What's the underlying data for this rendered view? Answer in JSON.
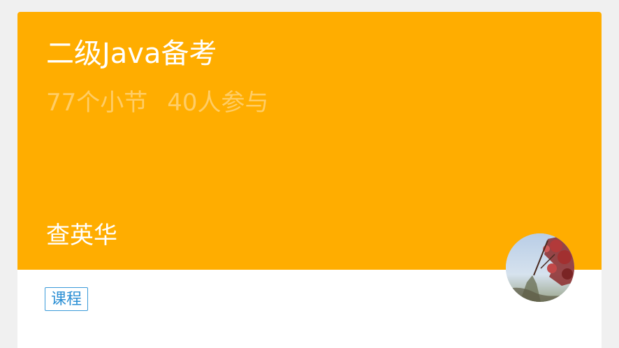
{
  "course": {
    "title": "二级Java备考",
    "sections": "77个小节",
    "participants": "40人参与",
    "teacher": "查英华",
    "type_tag": "课程"
  },
  "colors": {
    "banner": "#ffad00",
    "meta_text": "#ffcd66",
    "tag": "#2b8fd4"
  },
  "icons": {
    "avatar": "teacher-avatar-photo"
  }
}
